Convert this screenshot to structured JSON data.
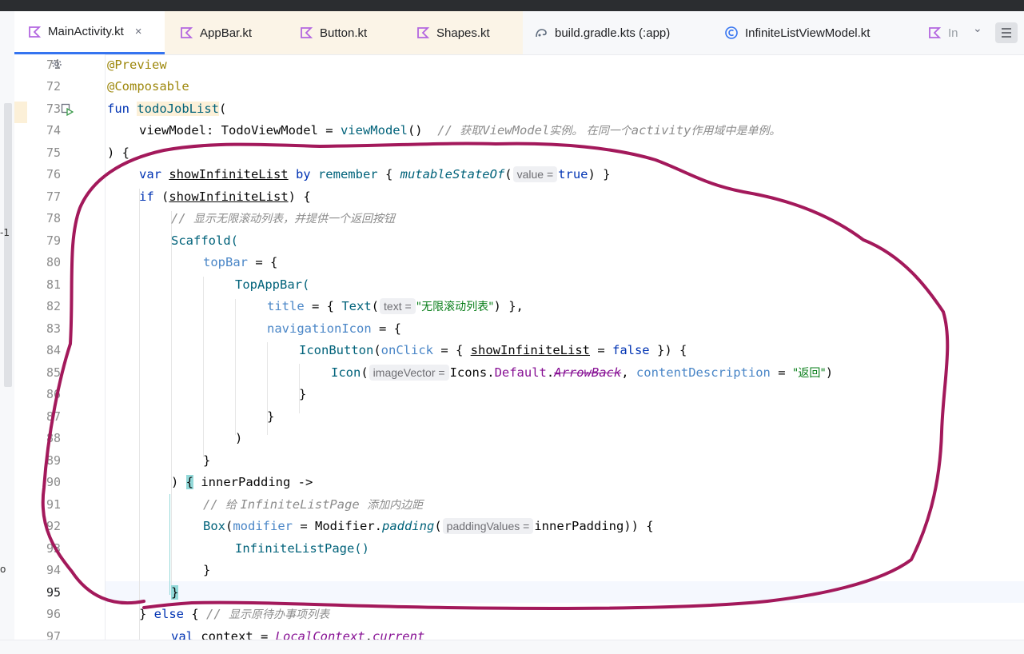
{
  "tabs": [
    {
      "label": "MainActivity.kt",
      "icon": "kotlin-file-icon",
      "active": true
    },
    {
      "label": "AppBar.kt",
      "icon": "kotlin-file-icon"
    },
    {
      "label": "Button.kt",
      "icon": "kotlin-file-icon"
    },
    {
      "label": "Shapes.kt",
      "icon": "kotlin-file-icon"
    },
    {
      "label": "build.gradle.kts (:app)",
      "icon": "gradle-file-icon"
    },
    {
      "label": "InfiniteListViewModel.kt",
      "icon": "kotlin-class-icon"
    },
    {
      "label": "In",
      "icon": "kotlin-file-icon"
    }
  ],
  "tab_close_glyph": "×",
  "overflow_chevron": "⌄",
  "edge_glyphs": {
    "a": "-1",
    "b": "o"
  },
  "line_numbers": [
    "71",
    "72",
    "73",
    "74",
    "75",
    "76",
    "77",
    "78",
    "79",
    "80",
    "81",
    "82",
    "83",
    "84",
    "85",
    "86",
    "87",
    "88",
    "89",
    "90",
    "91",
    "92",
    "93",
    "94",
    "95",
    "96",
    "97"
  ],
  "current_line": "95",
  "code": {
    "l71": "@Preview",
    "l72": "@Composable",
    "l73_kw": "fun ",
    "l73_name": "todoJobList",
    "l73_rest": "(",
    "l74_a": "viewModel: TodoViewModel = ",
    "l74_b": "viewModel",
    "l74_c": "()  ",
    "l74_cm1": "// ",
    "l74_cm2": "获取",
    "l74_cm3": "ViewModel",
    "l74_cm4": "实例。 在同一个",
    "l74_cm5": "activity",
    "l74_cm6": "作用域中是单例。",
    "l75": ") {",
    "l76_kw": "var ",
    "l76_name": "showInfiniteList",
    "l76_by": " by ",
    "l76_rem": "remember",
    "l76_b": " { ",
    "l76_ms": "mutableStateOf",
    "l76_p": "(",
    "l76_hint": "value =",
    "l76_true": "true",
    "l76_end": ") }",
    "l77_kw": "if ",
    "l77_a": "(",
    "l77_name": "showInfiniteList",
    "l77_b": ") {",
    "l78_cm": "// ",
    "l78_zh": "显示无限滚动列表，并提供一个返回按钮",
    "l79": "Scaffold(",
    "l80_p": "topBar",
    "l80_r": " = {",
    "l81": "TopAppBar(",
    "l82_p": "title",
    "l82_a": " = { ",
    "l82_fn": "Text",
    "l82_b": "(",
    "l82_hint": "text =",
    "l82_str": "\"无限滚动列表\"",
    "l82_c": ") },",
    "l83_p": "navigationIcon",
    "l83_r": " = {",
    "l84_fn": "IconButton",
    "l84_a": "(",
    "l84_p": "onClick",
    "l84_b": " = { ",
    "l84_name": "showInfiniteList",
    "l84_c": " = ",
    "l84_kw": "false",
    "l84_d": " }) {",
    "l85_fn": "Icon",
    "l85_a": "(",
    "l85_hint": "imageVector =",
    "l85_b": "Icons.",
    "l85_def": "Default",
    "l85_dot": ".",
    "l85_arrow": "ArrowBack",
    "l85_c": ", ",
    "l85_p": "contentDescription",
    "l85_d": " = ",
    "l85_str": "\"返回\"",
    "l85_e": ")",
    "l86": "}",
    "l87": "}",
    "l88": ")",
    "l89": "}",
    "l90_a": ") ",
    "l90_brace": "{",
    "l90_b": " innerPadding ->",
    "l91_cm": "// ",
    "l91_zh": "给 ",
    "l91_cm2": "InfiniteListPage ",
    "l91_zh2": "添加内边距",
    "l92_fn": "Box",
    "l92_a": "(",
    "l92_p": "modifier",
    "l92_b": " = Modifier.",
    "l92_pad": "padding",
    "l92_c": "(",
    "l92_hint": "paddingValues =",
    "l92_d": "innerPadding)) {",
    "l93": "InfiniteListPage()",
    "l94": "}",
    "l95": "}",
    "l96_a": "} ",
    "l96_kw": "else",
    "l96_b": " { ",
    "l96_cm": "// ",
    "l96_zh": "显示原待办事项列表",
    "l97_kw": "val ",
    "l97_a": "context = ",
    "l97_lc": "LocalContext",
    "l97_b": ".",
    "l97_cur": "current"
  },
  "colors": {
    "annotation_stroke": "#a3195b",
    "accent": "#3574f0"
  }
}
